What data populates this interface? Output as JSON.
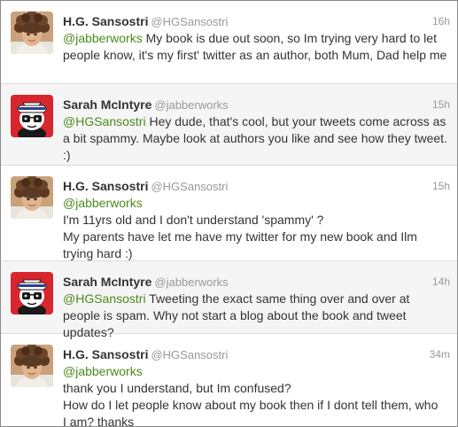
{
  "tweets": [
    {
      "name": "H.G. Sansostri",
      "handle": "@HGSansostri",
      "time": "16h",
      "avatar": "boy-curly-hair-avatar",
      "mention": "@jabberworks",
      "text": " My book is due out soon, so Im trying very hard to let people know, it's my first' twitter as an author, both Mum, Dad help me"
    },
    {
      "name": "Sarah McIntyre",
      "handle": "@jabberworks",
      "time": "15h",
      "avatar": "sailor-cartoon-avatar",
      "mention": "@HGSansostri",
      "text": " Hey dude, that's cool, but your tweets come across as a bit spammy. Maybe look at authors you like and see how they tweet. :)"
    },
    {
      "name": "H.G. Sansostri",
      "handle": "@HGSansostri",
      "time": "15h",
      "avatar": "boy-curly-hair-avatar",
      "mention": "@jabberworks",
      "lines": [
        "I'm 11yrs old and I don't understand 'spammy' ?",
        "My parents have let me have my twitter for my new book and Ilm",
        "trying hard  :)"
      ]
    },
    {
      "name": "Sarah McIntyre",
      "handle": "@jabberworks",
      "time": "14h",
      "avatar": "sailor-cartoon-avatar",
      "mention": "@HGSansostri",
      "text": " Tweeting the exact same thing over and over at people is spam. Why not start a blog about the book and tweet updates?"
    },
    {
      "name": "H.G. Sansostri",
      "handle": "@HGSansostri",
      "time": "34m",
      "avatar": "boy-curly-hair-avatar",
      "mention": "@jabberworks",
      "lines": [
        "thank you I understand, but Im confused?",
        "How do I let people know about my book then if I dont tell them, who",
        "I am? thanks"
      ]
    }
  ],
  "colors": {
    "mention": "#4b8a1c",
    "name": "#333333",
    "meta": "#999999",
    "alt_row": "#f5f5f5"
  }
}
